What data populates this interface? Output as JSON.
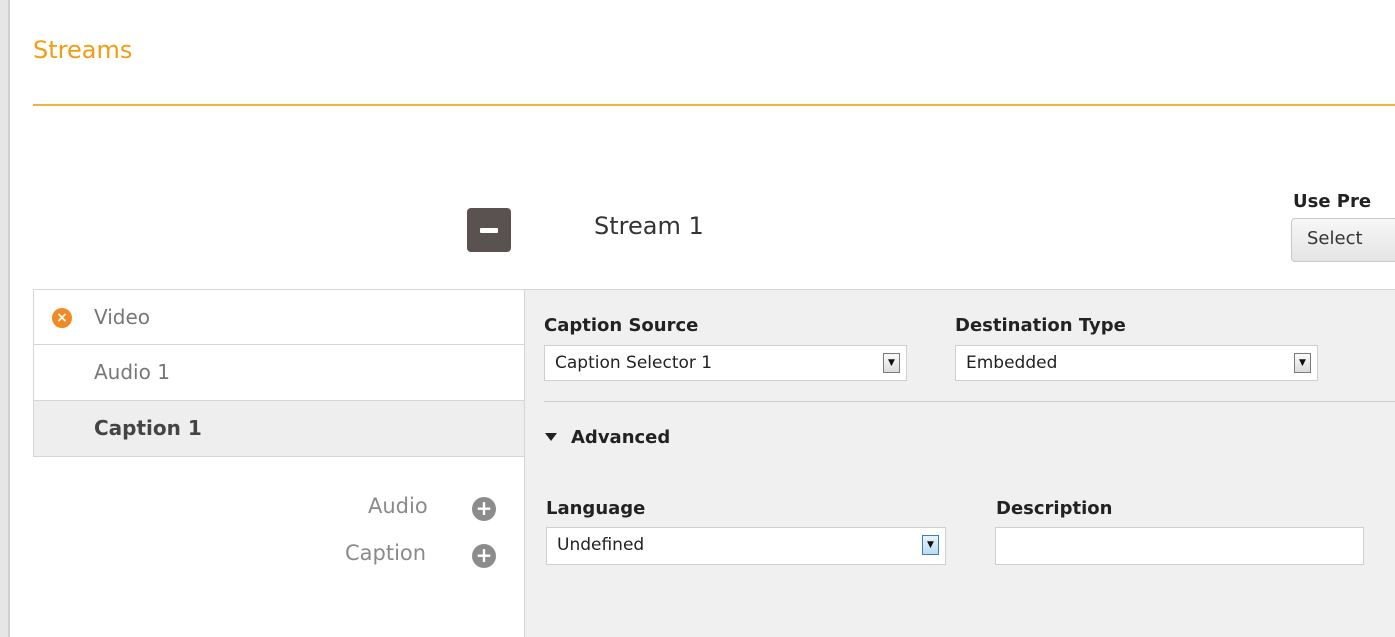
{
  "page": {
    "title": "Streams"
  },
  "stream": {
    "name": "Stream 1",
    "use_preset_label": "Use Pre",
    "select_button_label": "Select"
  },
  "tabs": [
    {
      "label": "Video",
      "icon": "remove-icon",
      "active": false
    },
    {
      "label": "Audio 1",
      "active": false
    },
    {
      "label": "Caption 1",
      "active": true
    }
  ],
  "add_actions": {
    "audio_label": "Audio",
    "caption_label": "Caption"
  },
  "caption_settings": {
    "caption_source": {
      "label": "Caption Source",
      "value": "Caption Selector 1"
    },
    "destination_type": {
      "label": "Destination Type",
      "value": "Embedded"
    },
    "advanced_label": "Advanced",
    "language": {
      "label": "Language",
      "value": "Undefined"
    },
    "description": {
      "label": "Description",
      "value": ""
    }
  },
  "colors": {
    "accent": "#f39c12",
    "remove_icon": "#f08a24",
    "panel_bg": "#f0f0f0"
  }
}
